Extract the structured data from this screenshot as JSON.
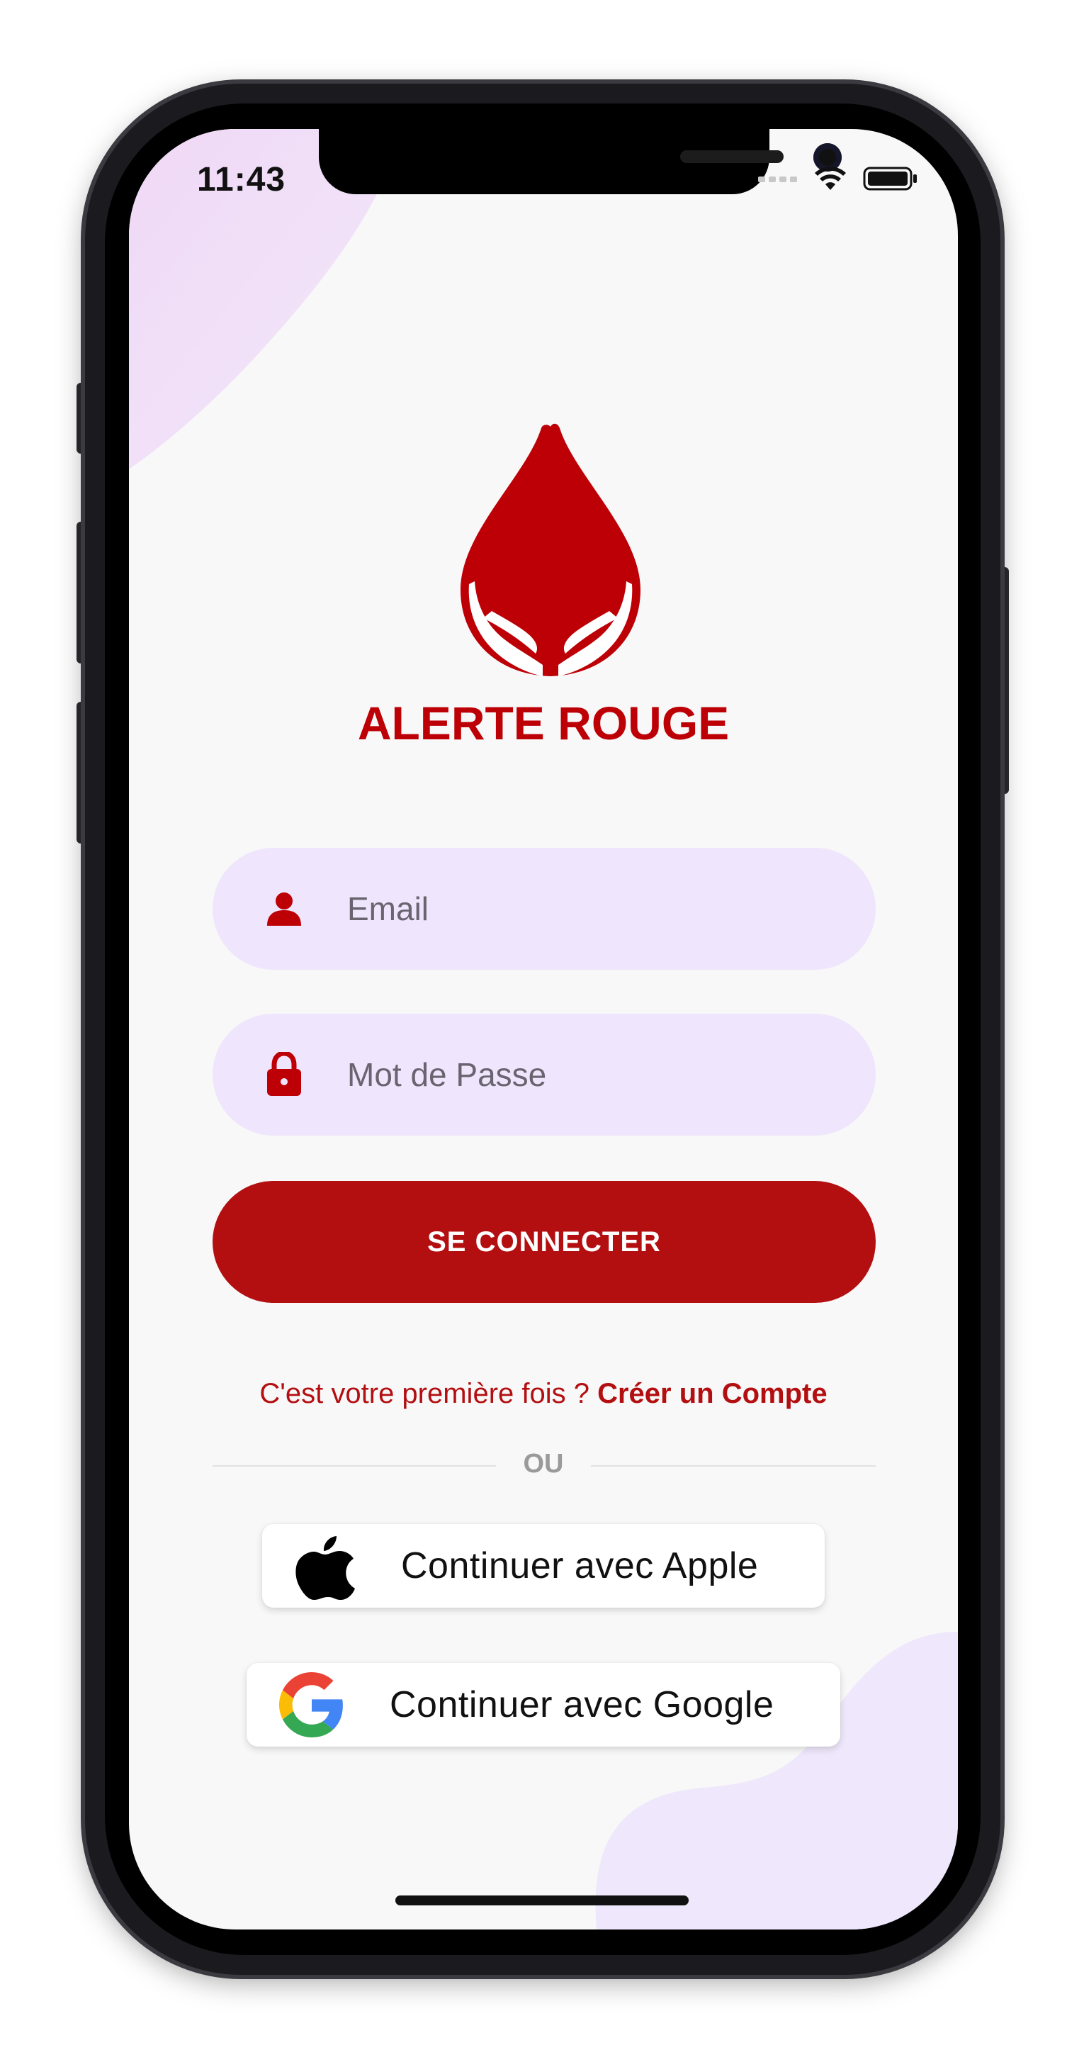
{
  "status_bar": {
    "time": "11:43"
  },
  "brand": {
    "name": "ALERTE ROUGE"
  },
  "form": {
    "email_placeholder": "Email",
    "password_placeholder": "Mot de Passe",
    "login_label": "SE CONNECTER"
  },
  "signup": {
    "prompt": "C'est votre première fois ? ",
    "link": "Créer un Compte"
  },
  "separator": "OU",
  "social": {
    "apple_label": "Continuer avec Apple",
    "google_label": "Continuer avec Google"
  },
  "icons": {
    "user": "user-icon",
    "lock": "lock-icon",
    "apple": "apple-logo-icon",
    "google": "google-logo-icon"
  },
  "colors": {
    "brand_red": "#bd0006",
    "button_red": "#b30f11",
    "field_bg": "#efe5fc",
    "screen_bg": "#f8f8f8"
  }
}
